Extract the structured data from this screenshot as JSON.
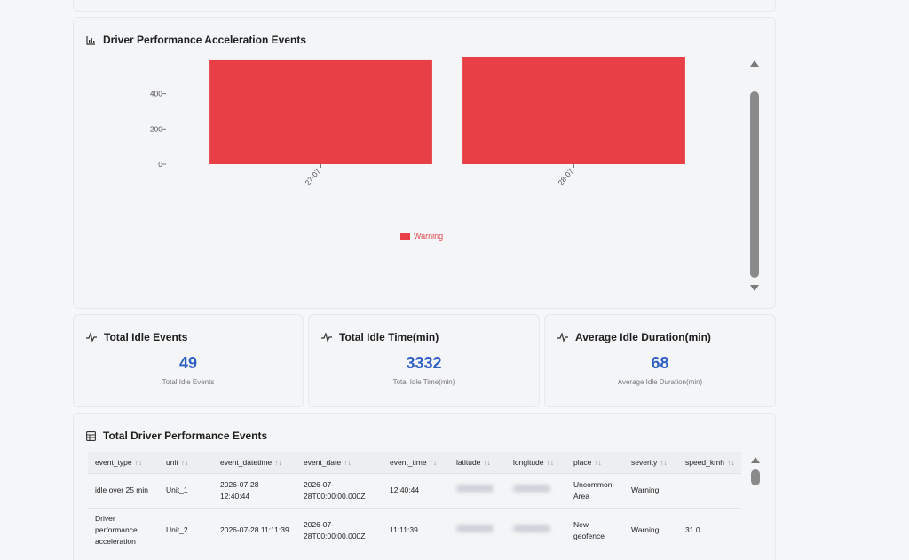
{
  "colors": {
    "bar": "#e83e45",
    "accent": "#2d5fc4",
    "card_bg": "#f4f5f7"
  },
  "chart_panel": {
    "title": "Driver Performance Acceleration Events",
    "icon": "bar-chart-icon"
  },
  "chart_data": {
    "type": "bar",
    "categories": [
      "27-07",
      "28-07"
    ],
    "series": [
      {
        "name": "Warning",
        "values": [
          590,
          610
        ]
      }
    ],
    "yticks": [
      "400",
      "200",
      "0"
    ],
    "ylim": [
      0,
      620
    ],
    "grid": false,
    "legend_position": "bottom-center"
  },
  "kpis": [
    {
      "title": "Total Idle Events",
      "value": "49",
      "sub": "Total Idle Events",
      "icon": "activity-icon"
    },
    {
      "title": "Total Idle Time(min)",
      "value": "3332",
      "sub": "Total Idle Time(min)",
      "icon": "activity-icon"
    },
    {
      "title": "Average Idle Duration(min)",
      "value": "68",
      "sub": "Average Idle Duration(min)",
      "icon": "activity-icon"
    }
  ],
  "table_panel": {
    "title": "Total Driver Performance Events",
    "icon": "table-icon",
    "sort_glyph": "↑↓",
    "columns": [
      "event_type",
      "unit",
      "event_datetime",
      "event_date",
      "event_time",
      "latitude",
      "longitude",
      "place",
      "severity",
      "speed_kmh"
    ],
    "rows": [
      {
        "event_type": "idle over 25 min",
        "unit": "Unit_1",
        "event_datetime": "2026-07-28 12:40:44",
        "event_date": "2026-07-28T00:00:00.000Z",
        "event_time": "12:40:44",
        "place": "Uncommon Area",
        "severity": "Warning",
        "speed_kmh": ""
      },
      {
        "event_type": "Driver performance acceleration",
        "unit": "Unit_2",
        "event_datetime": "2026-07-28 11:11:39",
        "event_date": "2026-07-28T00:00:00.000Z",
        "event_time": "11:11:39",
        "place": "New geofence",
        "severity": "Warning",
        "speed_kmh": "31.0"
      }
    ]
  }
}
